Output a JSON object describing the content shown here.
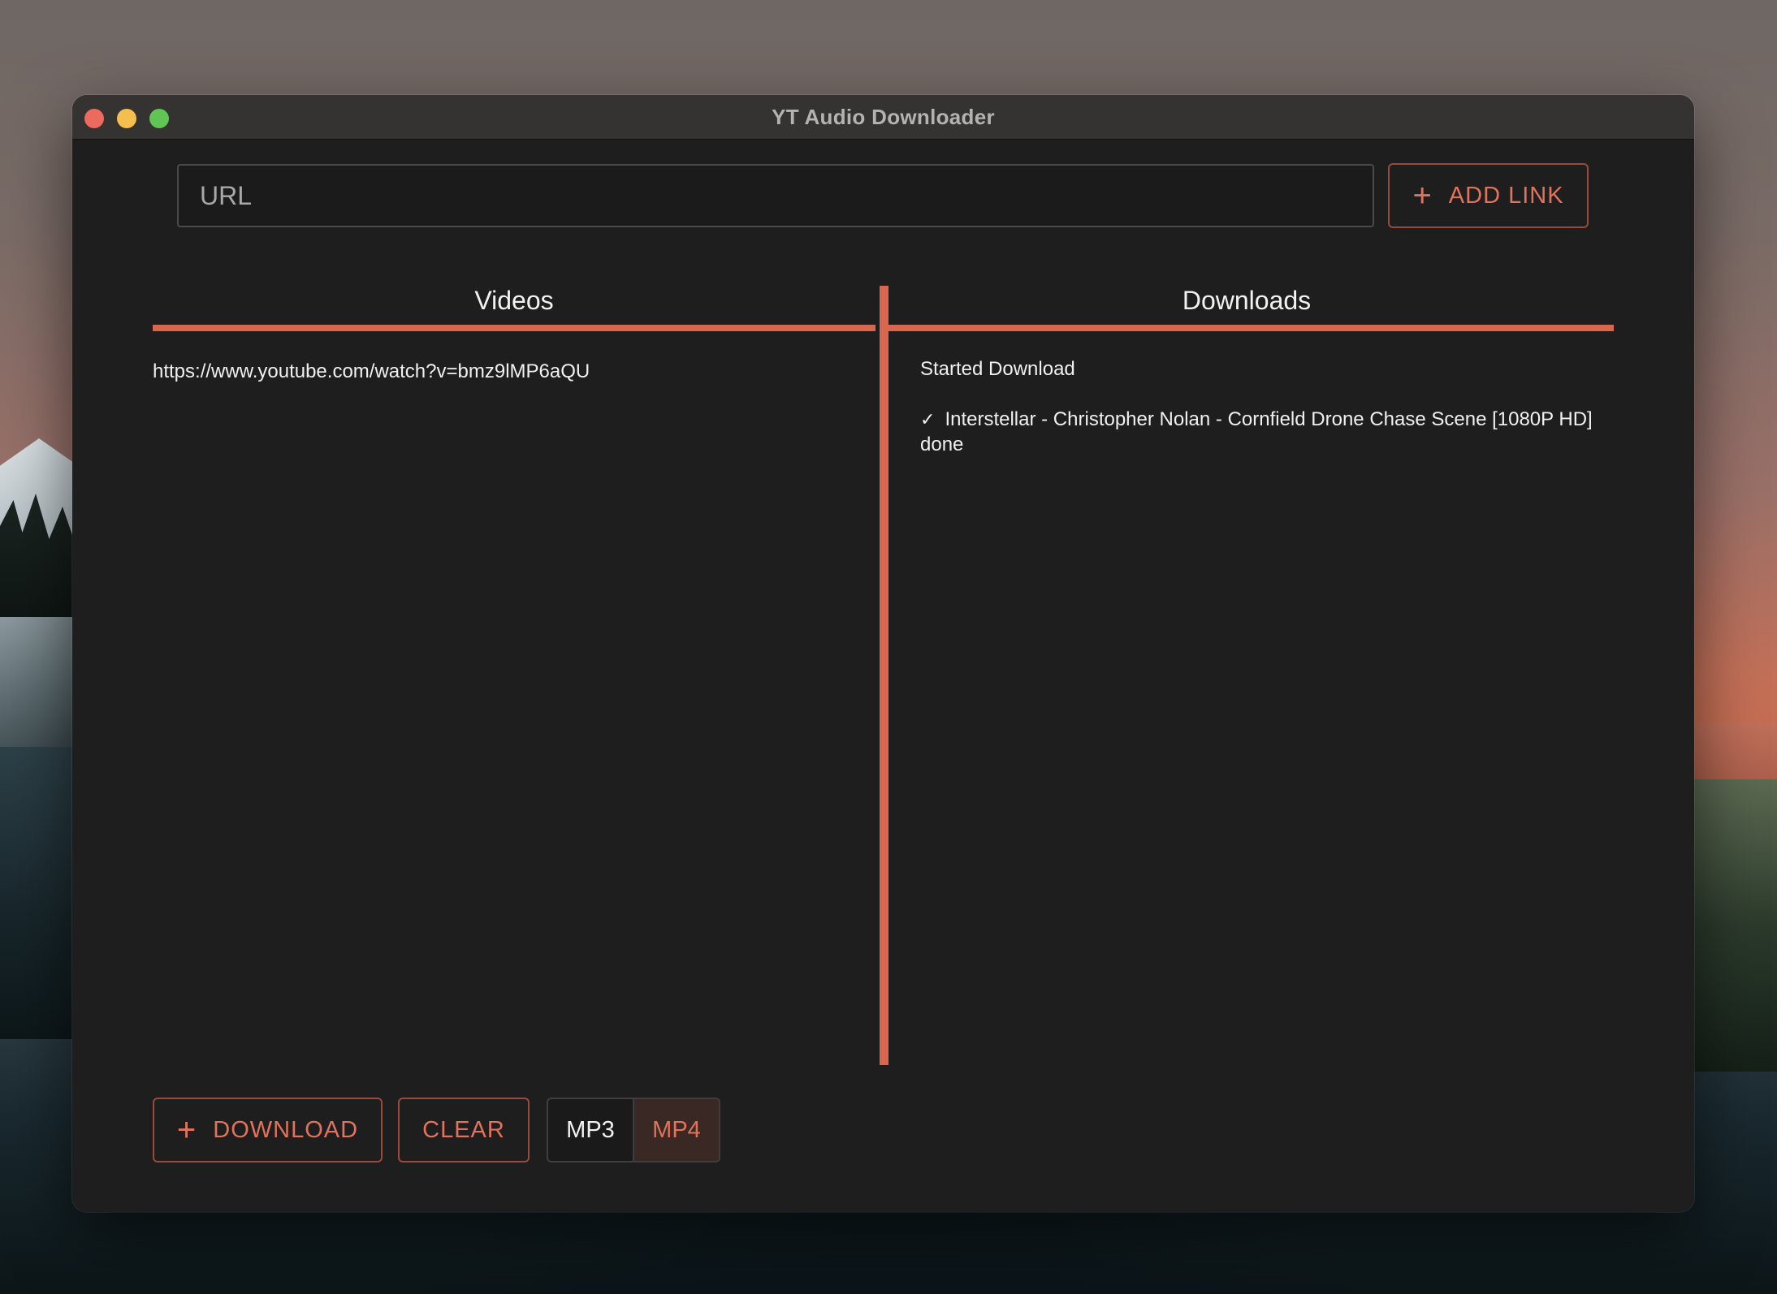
{
  "window": {
    "title": "YT Audio Downloader"
  },
  "toolbar": {
    "url_placeholder": "URL",
    "url_value": "",
    "add_link_label": "ADD LINK",
    "add_link_icon": "plus-icon"
  },
  "panels": {
    "videos_title": "Videos",
    "downloads_title": "Downloads"
  },
  "videos": [
    {
      "url": "https://www.youtube.com/watch?v=bmz9lMP6aQU"
    }
  ],
  "downloads": {
    "status": "Started Download",
    "items": [
      {
        "icon": "check-icon",
        "text": "Interstellar - Christopher Nolan - Cornfield Drone Chase Scene [1080P HD] done"
      }
    ]
  },
  "actions": {
    "download_label": "DOWNLOAD",
    "clear_label": "CLEAR",
    "format_options": [
      "MP3",
      "MP4"
    ],
    "selected_format": "MP4"
  },
  "colors": {
    "accent": "#d9674f",
    "background": "#1e1e1e",
    "text": "#f0f0f0"
  }
}
